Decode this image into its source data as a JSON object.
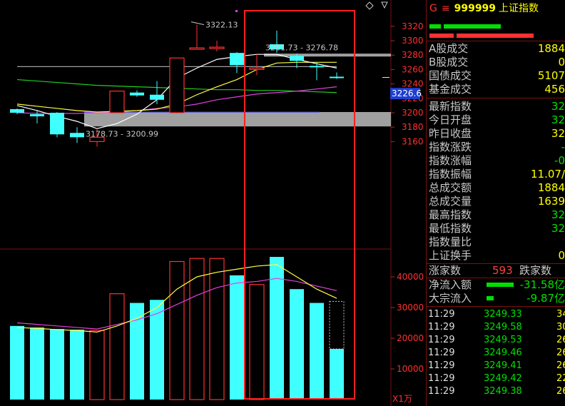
{
  "chart": {
    "candles": [
      {
        "o": 3200,
        "c": 3205,
        "h": 3206,
        "l": 3198,
        "dir": "down"
      },
      {
        "o": 3198,
        "c": 3195,
        "h": 3204,
        "l": 3185,
        "dir": "down"
      },
      {
        "o": 3200,
        "c": 3170,
        "h": 3201,
        "l": 3166,
        "dir": "down"
      },
      {
        "o": 3172,
        "c": 3166,
        "h": 3180,
        "l": 3158,
        "dir": "down"
      },
      {
        "o": 3160,
        "c": 3166,
        "h": 3178,
        "l": 3153,
        "dir": "up"
      },
      {
        "o": 3200,
        "c": 3230,
        "h": 3230,
        "l": 3199,
        "dir": "up"
      },
      {
        "o": 3224,
        "c": 3228,
        "h": 3231,
        "l": 3222,
        "dir": "down"
      },
      {
        "o": 3218,
        "c": 3225,
        "h": 3244,
        "l": 3212,
        "dir": "down"
      },
      {
        "o": 3200,
        "c": 3276,
        "h": 3276,
        "l": 3199,
        "dir": "up"
      },
      {
        "o": 3288,
        "c": 3290,
        "h": 3322.13,
        "l": 3288,
        "dir": "up"
      },
      {
        "o": 3289,
        "c": 3291,
        "h": 3300,
        "l": 3285,
        "dir": "up"
      },
      {
        "o": 3283,
        "c": 3266,
        "h": 3284,
        "l": 3255,
        "dir": "down"
      },
      {
        "o": 3262,
        "c": 3262,
        "h": 3282,
        "l": 3252,
        "dir": "up"
      },
      {
        "o": 3295,
        "c": 3288,
        "h": 3314,
        "l": 3283,
        "dir": "down"
      },
      {
        "o": 3279,
        "c": 3272,
        "h": 3282,
        "l": 3262,
        "dir": "down"
      },
      {
        "o": 3265,
        "c": 3265,
        "h": 3270,
        "l": 3245,
        "dir": "down"
      },
      {
        "o": 3250,
        "c": 3249,
        "h": 3256,
        "l": 3247,
        "dir": "down"
      }
    ],
    "volumes": [
      24000,
      23500,
      23000,
      22800,
      22500,
      34500,
      31500,
      32500,
      45000,
      46000,
      46000,
      40500,
      37500,
      46500,
      36000,
      31500,
      16500
    ],
    "vol_ghost": 32000,
    "ma_white": [
      3210,
      3203,
      3195,
      3188,
      3178,
      3185,
      3198,
      3218,
      3248,
      3262,
      3274,
      3278,
      3281,
      3281,
      3274,
      3268,
      3262
    ],
    "ma_yellow": [
      3212,
      3209,
      3206,
      3203,
      3201,
      3202,
      3203,
      3205,
      3212,
      3225,
      3236,
      3246,
      3260,
      3269,
      3270,
      3270,
      3270
    ],
    "ma_green": [
      3246,
      3244,
      3242,
      3240,
      3238,
      3237,
      3236,
      3235,
      3234,
      3233,
      3232,
      3232,
      3231,
      3231,
      3230,
      3229,
      3228
    ],
    "ma_magenta": [
      3200,
      3199,
      3199,
      3199,
      3200,
      3201,
      3203,
      3206,
      3208,
      3212,
      3218,
      3222,
      3226,
      3228,
      3230,
      3233,
      3236
    ],
    "ma_flat": [
      3264,
      3264,
      3264,
      3264,
      3264,
      3264,
      3264,
      3264,
      3264,
      3264,
      3264,
      3264,
      3264,
      3264,
      3264,
      3264,
      3264
    ],
    "vma_yellow": [
      23500,
      23200,
      22800,
      22500,
      22000,
      24000,
      26500,
      30000,
      36000,
      40000,
      41500,
      42500,
      43500,
      44000,
      40000,
      36000,
      33000
    ],
    "vma_magenta": [
      25000,
      24500,
      24000,
      23500,
      23000,
      24500,
      26000,
      28000,
      31000,
      34000,
      36500,
      38000,
      38500,
      39500,
      38500,
      37000,
      35500
    ],
    "axis_price": [
      "3320",
      "3300",
      "3280",
      "3260",
      "3240",
      "3220",
      "3200",
      "3180",
      "3160"
    ],
    "axis_vol": [
      "40000",
      "30000",
      "20000",
      "10000"
    ],
    "unit_label": "X1万",
    "current_price": "3226.6",
    "high_label": "3322.13",
    "range_top_label": "3281.73 - 3276.78",
    "range_bottom_label": "3178.73 - 3200.99",
    "colors": {
      "up": "#ff3030",
      "down": "#40ffff",
      "highlight": "#ff2020"
    }
  },
  "panel": {
    "header": {
      "g": "G",
      "eq": "≡",
      "code": "999999",
      "name": "上证指数"
    },
    "stats": [
      {
        "label": "A股成交",
        "value": "1884"
      },
      {
        "label": "B股成交",
        "value": "0"
      },
      {
        "label": "国债成交",
        "value": "5107"
      },
      {
        "label": "基金成交",
        "value": "456"
      }
    ],
    "quote": [
      {
        "label": "最新指数",
        "value": "32",
        "color": "green"
      },
      {
        "label": "今日开盘",
        "value": "32",
        "color": "green"
      },
      {
        "label": "昨日收盘",
        "value": "32",
        "color": "yellow"
      },
      {
        "label": "指数涨跌",
        "value": "-",
        "color": "green"
      },
      {
        "label": "指数涨幅",
        "value": "-0",
        "color": "green"
      },
      {
        "label": "指数振幅",
        "value": "11.07/",
        "color": "yellow"
      },
      {
        "label": "总成交额",
        "value": "1884",
        "color": "yellow"
      },
      {
        "label": "总成交量",
        "value": "1639",
        "color": "yellow"
      },
      {
        "label": "最高指数",
        "value": "32",
        "color": "green"
      },
      {
        "label": "最低指数",
        "value": "32",
        "color": "green"
      },
      {
        "label": "指数量比",
        "value": "",
        "color": "yellow"
      },
      {
        "label": "上证换手",
        "value": "0",
        "color": "yellow"
      }
    ],
    "breadth": {
      "up_label": "涨家数",
      "up_value": "593",
      "down_label": "跌家数"
    },
    "flows": [
      {
        "label": "净流入额",
        "value": "-31.58亿"
      },
      {
        "label": "大宗流入",
        "value": "-9.87亿"
      }
    ],
    "ticks": [
      {
        "t": "11:29",
        "p": "3249.33",
        "v": "34"
      },
      {
        "t": "11:29",
        "p": "3249.58",
        "v": "30"
      },
      {
        "t": "11:29",
        "p": "3249.53",
        "v": "26"
      },
      {
        "t": "11:29",
        "p": "3249.46",
        "v": "26"
      },
      {
        "t": "11:29",
        "p": "3249.41",
        "v": "26"
      },
      {
        "t": "11:29",
        "p": "3249.42",
        "v": "22"
      },
      {
        "t": "11:29",
        "p": "3249.38",
        "v": "26"
      }
    ]
  }
}
